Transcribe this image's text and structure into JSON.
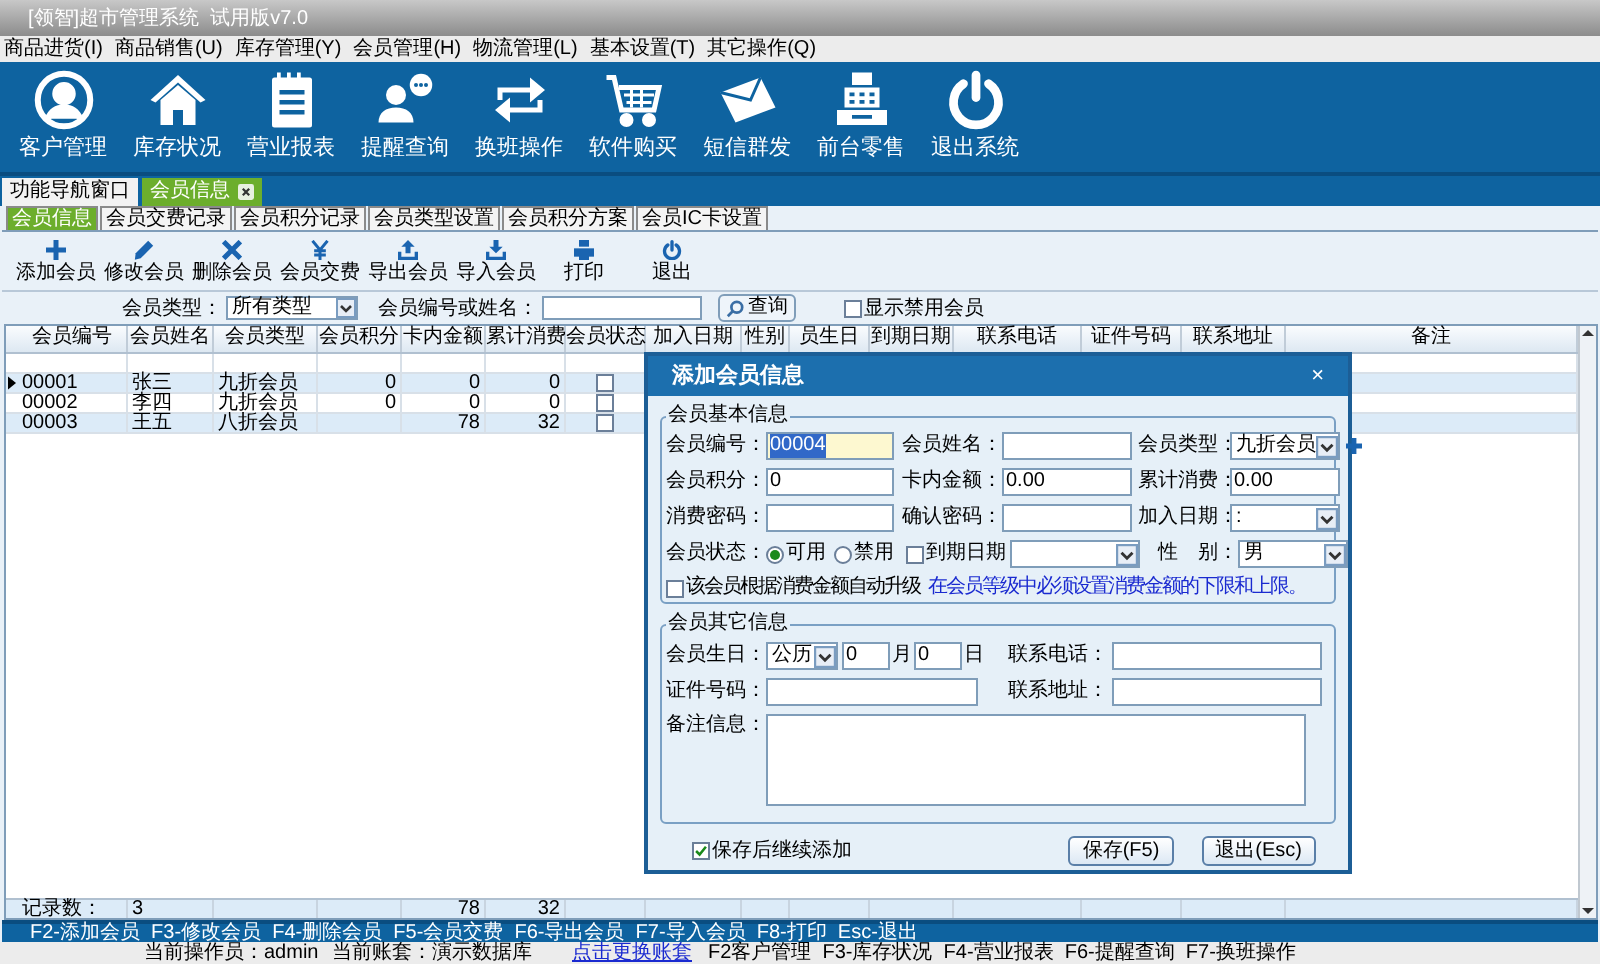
{
  "window": {
    "title": "[领智]超市管理系统  试用版v7.0"
  },
  "menu": [
    "商品进货(I)",
    "商品销售(U)",
    "库存管理(Y)",
    "会员管理(H)",
    "物流管理(L)",
    "基本设置(T)",
    "其它操作(Q)"
  ],
  "nav": [
    {
      "label": "客户管理",
      "kind": "person"
    },
    {
      "label": "库存状况",
      "kind": "house"
    },
    {
      "label": "营业报表",
      "kind": "notepad"
    },
    {
      "label": "提醒查询",
      "kind": "chat"
    },
    {
      "label": "换班操作",
      "kind": "swap"
    },
    {
      "label": "软件购买",
      "kind": "cart"
    },
    {
      "label": "短信群发",
      "kind": "envelope"
    },
    {
      "label": "前台零售",
      "kind": "register"
    },
    {
      "label": "退出系统",
      "kind": "power"
    }
  ],
  "tabs": [
    {
      "label": "功能导航窗口",
      "selected": false,
      "closable": false
    },
    {
      "label": "会员信息",
      "selected": true,
      "closable": true
    }
  ],
  "subtabs": [
    {
      "label": "会员信息",
      "selected": true
    },
    {
      "label": "会员交费记录",
      "selected": false
    },
    {
      "label": "会员积分记录",
      "selected": false
    },
    {
      "label": "会员类型设置",
      "selected": false
    },
    {
      "label": "会员积分方案",
      "selected": false
    },
    {
      "label": "会员IC卡设置",
      "selected": false
    }
  ],
  "toolbar": [
    {
      "label": "添加会员",
      "kind": "plus"
    },
    {
      "label": "修改会员",
      "kind": "pencil"
    },
    {
      "label": "删除会员",
      "kind": "cross"
    },
    {
      "label": "会员交费",
      "kind": "yen"
    },
    {
      "label": "导出会员",
      "kind": "upload"
    },
    {
      "label": "导入会员",
      "kind": "download"
    },
    {
      "label": "打印",
      "kind": "printer"
    },
    {
      "label": "退出",
      "kind": "power"
    }
  ],
  "filter": {
    "type_label": "会员类型：",
    "type_value": "所有类型",
    "search_label": "会员编号或姓名：",
    "search_button": "查询",
    "show_disabled": {
      "label": "显示禁用会员",
      "checked": false
    }
  },
  "table": {
    "columns": [
      "会员编号",
      "会员姓名",
      "会员类型",
      "会员积分",
      "卡内金额",
      "累计消费",
      "会员状态",
      "加入日期",
      "性别",
      "员生日",
      "到期日期",
      "联系电话",
      "证件号码",
      "联系地址",
      "备注"
    ],
    "rows": [
      {
        "cells": [
          "00001",
          "张三",
          "九折会员",
          "0",
          "0",
          "0"
        ],
        "status_checked": false,
        "selected": true
      },
      {
        "cells": [
          "00002",
          "李四",
          "九折会员",
          "0",
          "0",
          "0"
        ],
        "status_checked": false,
        "selected": false
      },
      {
        "cells": [
          "00003",
          "王五",
          "八折会员",
          "",
          "78",
          "32"
        ],
        "status_checked": false,
        "selected": false
      }
    ],
    "footer": {
      "label": "记录数：",
      "count": "3",
      "balance": "78",
      "spent": "32"
    }
  },
  "hotkeys": "F2-添加会员  F3-修改会员  F4-删除会员  F5-会员交费  F6-导出会员  F7-导入会员  F8-打印  Esc-退出",
  "status": {
    "operator": "当前操作员：admin",
    "account": "当前账套：演示数据库",
    "change_link": "点击更换账套",
    "shortcuts": "F2客户管理  F3-库存状况  F4-营业报表  F6-提醒查询  F7-换班操作"
  },
  "dialog": {
    "title": "添加会员信息",
    "close": "×",
    "basic": {
      "title": "会员基本信息",
      "rows": [
        [
          {
            "kind": "input",
            "label": "会员编号：",
            "value": "00004",
            "focused": true
          },
          {
            "kind": "input",
            "label": "会员姓名："
          },
          {
            "kind": "select",
            "label": "会员类型：",
            "value": "九折会员",
            "add": true
          }
        ],
        [
          {
            "kind": "input",
            "label": "会员积分：",
            "value": "0"
          },
          {
            "kind": "input",
            "label": "卡内金额：",
            "value": "0.00"
          },
          {
            "kind": "input",
            "label": "累计消费：",
            "value": "0.00"
          }
        ],
        [
          {
            "kind": "input",
            "label": "消费密码："
          },
          {
            "kind": "input",
            "label": "确认密码："
          },
          {
            "kind": "select",
            "label": "加入日期：",
            "value": ":"
          }
        ],
        [
          {
            "kind": "radios",
            "label": "会员状态：",
            "options": [
              {
                "label": "可用",
                "selected": true
              },
              {
                "label": "禁用",
                "selected": false
              }
            ]
          },
          {
            "kind": "checkselect",
            "label": "到期日期",
            "checked": false
          },
          {
            "kind": "select",
            "label": "性　别：",
            "value": "男"
          }
        ]
      ],
      "auto_upgrade": {
        "label": "该会员根据消费金额自动升级",
        "checked": false
      },
      "note": "在会员等级中必须设置消费金额的下限和上限。"
    },
    "other": {
      "title": "会员其它信息",
      "birthday_label": "会员生日：",
      "calendar": "公历",
      "month": "0",
      "month_label": "月",
      "day": "0",
      "day_label": "日",
      "phone_label": "联系电话：",
      "id_label": "证件号码：",
      "address_label": "联系地址：",
      "remark_label": "备注信息："
    },
    "keep_adding": {
      "label": "保存后继续添加",
      "checked": true
    },
    "buttons": [
      "保存(F5)",
      "退出(Esc)"
    ]
  }
}
